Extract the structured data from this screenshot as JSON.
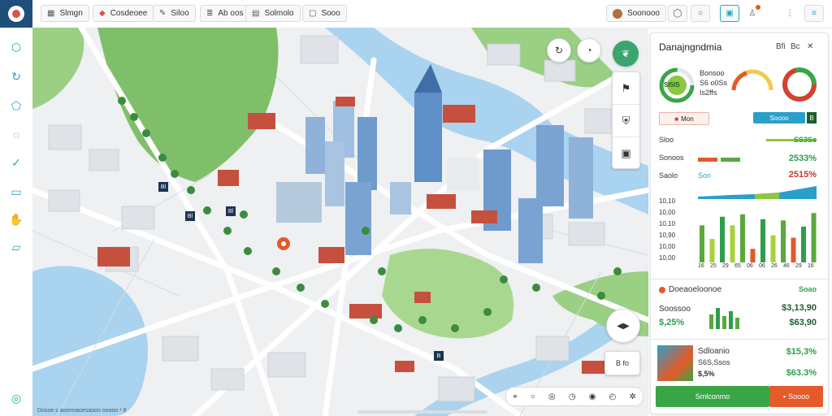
{
  "toolbar": {
    "items": [
      {
        "icon": "map-icon",
        "label": "Slmgn"
      },
      {
        "icon": "shield-icon",
        "label": "Cosdeoee"
      },
      {
        "icon": "pen-icon",
        "label": "Siloo"
      },
      {
        "icon": "layers-icon",
        "label": "Ab oos"
      },
      {
        "icon": "chart-icon",
        "label": "Solmolo"
      },
      {
        "icon": "box-icon",
        "label": "Sooo"
      }
    ],
    "user_label": "Soonooo",
    "right_icons": [
      "circle-icon",
      "search-icon",
      "screen-icon",
      "user-icon",
      "menu-icon",
      "list-icon"
    ]
  },
  "sidebar": {
    "items": [
      "cube-icon",
      "refresh-icon",
      "shield-icon",
      "chat-icon",
      "check-circle-icon",
      "document-icon",
      "hand-icon",
      "folder-icon",
      "help-icon"
    ]
  },
  "map": {
    "markers": [
      {
        "label": "Bl"
      },
      {
        "label": "Bl"
      },
      {
        "label": "Bl"
      },
      {
        "label": "B"
      }
    ],
    "tools": [
      "leaf-icon",
      "walk-icon",
      "shield-icon",
      "bag-icon"
    ],
    "bottom_tools": [
      "locate-icon",
      "circle-icon",
      "target-icon",
      "clock-icon",
      "pin-icon",
      "time-icon",
      "settings-icon"
    ],
    "corner_label": "B fo",
    "attribution": "Dosoe s aoonnaoesaooo ooooo ¹ 8"
  },
  "panel": {
    "title": "Danajngndmia",
    "title_controls": [
      "Bfi",
      "Bc",
      "✕"
    ],
    "kpis": [
      {
        "label": "Bonsoo",
        "sub1": "S6 o0Ss",
        "sub2": "Is2ffs"
      },
      {
        "label": "SI5IS",
        "sub1": "",
        "sub2": ""
      }
    ],
    "tags": [
      "Mon",
      "Soooo"
    ],
    "badge": "B",
    "rows": [
      {
        "label": "Sloo",
        "value": "SS3Ss",
        "color": "#2e9e4d"
      },
      {
        "label": "Sonoos",
        "value": "2533%",
        "color": "#2e9e4d"
      },
      {
        "label": "Saolo",
        "value": "2515%",
        "color": "#c8382d"
      }
    ],
    "row_mid": "Son",
    "y_ticks": [
      "10,10",
      "10,00",
      "10,10",
      "10,90",
      "10,00",
      "10,00",
      "10,10"
    ],
    "x_ticks": [
      "16",
      "25",
      "29",
      "65",
      "06",
      "06",
      "26",
      "46",
      "29",
      "16"
    ],
    "bars": [
      {
        "value": 60,
        "color": "#5ba83c"
      },
      {
        "value": 38,
        "color": "#a7d13b"
      },
      {
        "value": 74,
        "color": "#2e9e4d"
      },
      {
        "value": 60,
        "color": "#a7d13b"
      },
      {
        "value": 78,
        "color": "#5ba83c"
      },
      {
        "value": 22,
        "color": "#e05a2b"
      },
      {
        "value": 70,
        "color": "#2e9e4d"
      },
      {
        "value": 44,
        "color": "#a7d13b"
      },
      {
        "value": 68,
        "color": "#5ba83c"
      },
      {
        "value": 40,
        "color": "#e05a2b"
      },
      {
        "value": 58,
        "color": "#2e9e4d"
      },
      {
        "value": 80,
        "color": "#5ba83c"
      }
    ],
    "section2": {
      "title": "Doeaoeloonoe",
      "right": "Soao",
      "rows": [
        {
          "left": "Soossoo",
          "right": "$3,13,90"
        },
        {
          "left": "$,25%",
          "right": "$63,90"
        }
      ]
    },
    "section3": {
      "title": "Sdloanio",
      "sub": "S6S,Ssos",
      "vals": [
        "$15,3%",
        "$,5%",
        "$63.3%"
      ]
    },
    "buttons": [
      {
        "label": "Smlconmo",
        "color": "#3aa545"
      },
      {
        "label": "Soooo",
        "color": "#e45a2a"
      }
    ]
  },
  "colors": {
    "accent": "#2aa7b8",
    "brand": "#1e4e79",
    "green": "#3aa545",
    "orange": "#e45a2a"
  }
}
